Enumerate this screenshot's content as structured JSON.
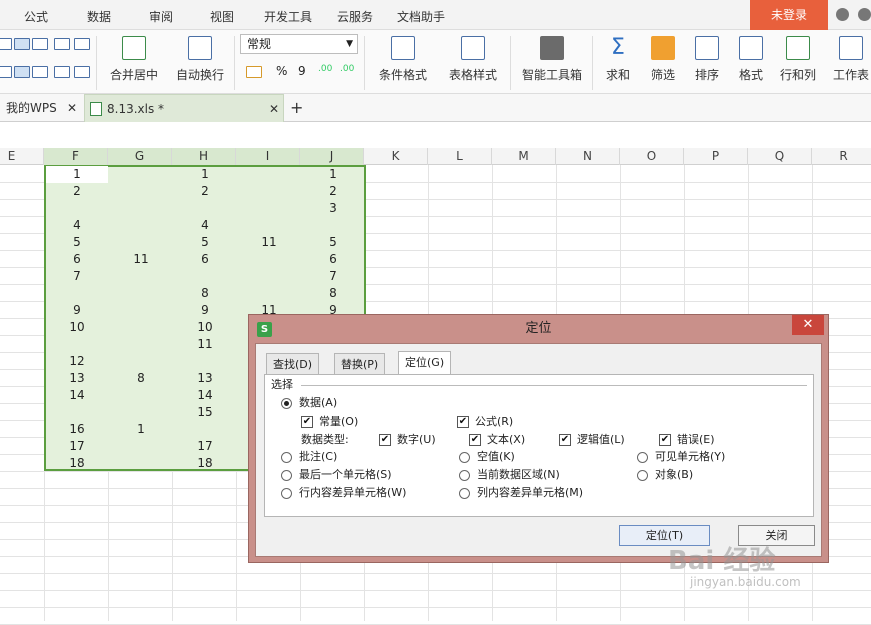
{
  "menubar": {
    "items": [
      "公式",
      "数据",
      "审阅",
      "视图",
      "开发工具",
      "云服务",
      "文档助手"
    ],
    "login": "未登录"
  },
  "ribbon": {
    "merge_center": "合并居中",
    "wrap_text": "自动换行",
    "number_format": "常规",
    "percent": "%",
    "comma": "9",
    "cond_format": "条件格式",
    "table_style": "表格样式",
    "smart_toolbox": "智能工具箱",
    "sum": "求和",
    "filter": "筛选",
    "sort": "排序",
    "format": "格式",
    "row_col": "行和列",
    "worksheet": "工作表"
  },
  "tabs": {
    "home": "我的WPS",
    "file": "8.13.xls *",
    "add": "+"
  },
  "sheet": {
    "columns": [
      "E",
      "F",
      "G",
      "H",
      "I",
      "J",
      "K",
      "L",
      "M",
      "N",
      "O",
      "P",
      "Q",
      "R"
    ],
    "rows": [
      {
        "F": "1",
        "G": "",
        "H": "1",
        "I": "",
        "J": "1"
      },
      {
        "F": "2",
        "G": "",
        "H": "2",
        "I": "",
        "J": "2"
      },
      {
        "F": "",
        "G": "",
        "H": "",
        "I": "",
        "J": "3"
      },
      {
        "F": "4",
        "G": "",
        "H": "4",
        "I": "",
        "J": ""
      },
      {
        "F": "5",
        "G": "",
        "H": "5",
        "I": "11",
        "J": "5"
      },
      {
        "F": "6",
        "G": "11",
        "H": "6",
        "I": "",
        "J": "6"
      },
      {
        "F": "7",
        "G": "",
        "H": "",
        "I": "",
        "J": "7"
      },
      {
        "F": "",
        "G": "",
        "H": "8",
        "I": "",
        "J": "8"
      },
      {
        "F": "9",
        "G": "",
        "H": "9",
        "I": "11",
        "J": "9"
      },
      {
        "F": "10",
        "G": "",
        "H": "10",
        "I": "",
        "J": ""
      },
      {
        "F": "",
        "G": "",
        "H": "11",
        "I": "",
        "J": ""
      },
      {
        "F": "12",
        "G": "",
        "H": "",
        "I": "",
        "J": ""
      },
      {
        "F": "13",
        "G": "8",
        "H": "13",
        "I": "",
        "J": ""
      },
      {
        "F": "14",
        "G": "",
        "H": "14",
        "I": "",
        "J": ""
      },
      {
        "F": "",
        "G": "",
        "H": "15",
        "I": "",
        "J": ""
      },
      {
        "F": "16",
        "G": "1",
        "H": "",
        "I": "",
        "J": ""
      },
      {
        "F": "17",
        "G": "",
        "H": "17",
        "I": "",
        "J": ""
      },
      {
        "F": "18",
        "G": "",
        "H": "18",
        "I": "",
        "J": ""
      }
    ]
  },
  "dialog": {
    "title": "定位",
    "close": "✕",
    "tabs": [
      "查找(D)",
      "替换(P)",
      "定位(G)"
    ],
    "group_label": "选择",
    "options": {
      "data": "数据(A)",
      "constant": "常量(O)",
      "formula": "公式(R)",
      "data_type_label": "数据类型:",
      "number": "数字(U)",
      "text": "文本(X)",
      "logical": "逻辑值(L)",
      "error": "错误(E)",
      "comment": "批注(C)",
      "blank": "空值(K)",
      "visible": "可见单元格(Y)",
      "last_cell": "最后一个单元格(S)",
      "current_region": "当前数据区域(N)",
      "object": "对象(B)",
      "row_diff": "行内容差异单元格(W)",
      "col_diff": "列内容差异单元格(M)"
    },
    "locate_button": "定位(T)",
    "close_button": "关闭"
  },
  "watermark": {
    "brand": "Bai 经验",
    "url": "jingyan.baidu.com"
  },
  "colors": {
    "accent": "#e8603c",
    "selection_fill": "#e4f1dc",
    "selection_border": "#5b9e3f",
    "dialog_frame": "#c9908a",
    "highlight": "#e0362c"
  }
}
